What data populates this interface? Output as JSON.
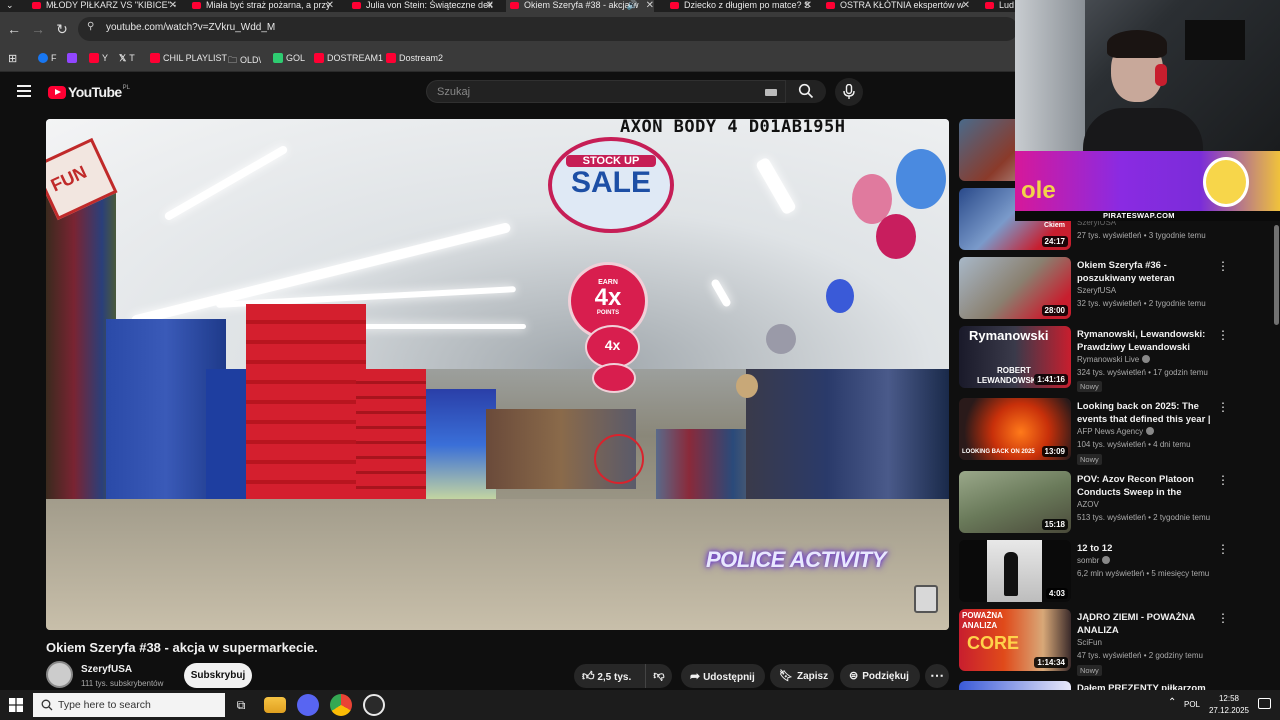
{
  "browser": {
    "tabs": [
      {
        "title": "MŁODY PIŁKARZ VS \"KIBICE\" -"
      },
      {
        "title": "Miała być straż pożarna, a przy"
      },
      {
        "title": "Julia von Stein: Świąteczne dek"
      },
      {
        "title": "Okiem Szeryfa #38 - akcja w"
      },
      {
        "title": "Dziecko z długiem po matce? S"
      },
      {
        "title": "OSTRA KŁÓTNIA ekspertów w"
      },
      {
        "title": "Lud"
      }
    ],
    "url": "youtube.com/watch?v=ZVkru_Wdd_M",
    "bookmarks": [
      {
        "label": "F"
      },
      {
        "label": ""
      },
      {
        "label": "Y"
      },
      {
        "label": "T"
      },
      {
        "label": "CHIL PLAYLIST"
      },
      {
        "label": "OLD\\"
      },
      {
        "label": "GOL"
      },
      {
        "label": "DOSTREAM1"
      },
      {
        "label": "Dostream2"
      }
    ]
  },
  "youtube": {
    "logo_text": "YouTube",
    "country_code": "PL",
    "search_placeholder": "Szukaj"
  },
  "video": {
    "bodycam_overlay": "AXON BODY 4 D01AB195H",
    "sign_sale_top": "STOCK UP",
    "sign_sale_bottom": "SALE",
    "sign_earn": "EARN",
    "sign_4x": "4x",
    "sign_points": "POINTS",
    "watermark": "POLICE ACTIVITY",
    "fun_sign": "FUN",
    "title": "Okiem Szeryfa #38 - akcja w supermarkecie.",
    "channel_name": "SzeryfUSA",
    "channel_subs": "111 tys. subskrybentów",
    "subscribe_label": "Subskrybuj",
    "likes": "2,5 tys.",
    "share_label": "Udostępnij",
    "save_label": "Zapisz",
    "thanks_label": "Podziękuj"
  },
  "sidebar": {
    "items": [
      {
        "title": "",
        "channel": "",
        "meta": "",
        "duration": "",
        "new": ""
      },
      {
        "title": "",
        "channel": "SzeryfUSA",
        "meta": "27 tys. wyświetleń • 3 tygodnie temu",
        "duration": "24:17",
        "new": ""
      },
      {
        "title": "Okiem Szeryfa #36 - poszukiwany weteran",
        "channel": "SzeryfUSA",
        "meta": "32 tys. wyświetleń • 2 tygodnie temu",
        "duration": "28:00",
        "new": ""
      },
      {
        "title": "Rymanowski, Lewandowski: Prawdziwy Lewandowski",
        "channel": "Rymanowski Live",
        "meta": "324 tys. wyświetleń • 17 godzin temu",
        "duration": "1:41:16",
        "new": "Nowy"
      },
      {
        "title": "Looking back on 2025: The events that defined this year | ...",
        "channel": "AFP News Agency",
        "meta": "104 tys. wyświetleń • 4 dni temu",
        "duration": "13:09",
        "new": "Nowy"
      },
      {
        "title": "POV: Azov Recon Platoon Conducts Sweep in the Torets...",
        "channel": "AZOV",
        "meta": "513 tys. wyświetleń • 2 tygodnie temu",
        "duration": "15:18",
        "new": ""
      },
      {
        "title": "12 to 12",
        "channel": "sombr",
        "meta": "6,2 mln wyświetleń • 5 miesięcy temu",
        "duration": "4:03",
        "new": ""
      },
      {
        "title": "JĄDRO ZIEMI - POWAŻNA ANALIZA",
        "channel": "SciFun",
        "meta": "47 tys. wyświetleń • 2 godziny temu",
        "duration": "1:14:34",
        "new": "Nowy"
      },
      {
        "title": "Dałem PREZENTY piłkarzom FC",
        "channel": "",
        "meta": "",
        "duration": "",
        "new": ""
      }
    ],
    "thumb_texts": {
      "rymanowski": "Rymanowski",
      "robert": "ROBERT",
      "lewandowski": "LEWANDOWSKI",
      "looking_back": "LOOKING BACK ON 2025",
      "powazna": "POWAŻNA",
      "analiza": "ANALIZA",
      "core": "CORE",
      "ckiem": "Ckiem"
    }
  },
  "overlay": {
    "promo_domain": "PIRATESWAP.COM",
    "promo_partial": "ole"
  },
  "taskbar": {
    "search_placeholder": "Type here to search",
    "language": "POL",
    "time": "12:58",
    "date": "27.12.2025"
  }
}
